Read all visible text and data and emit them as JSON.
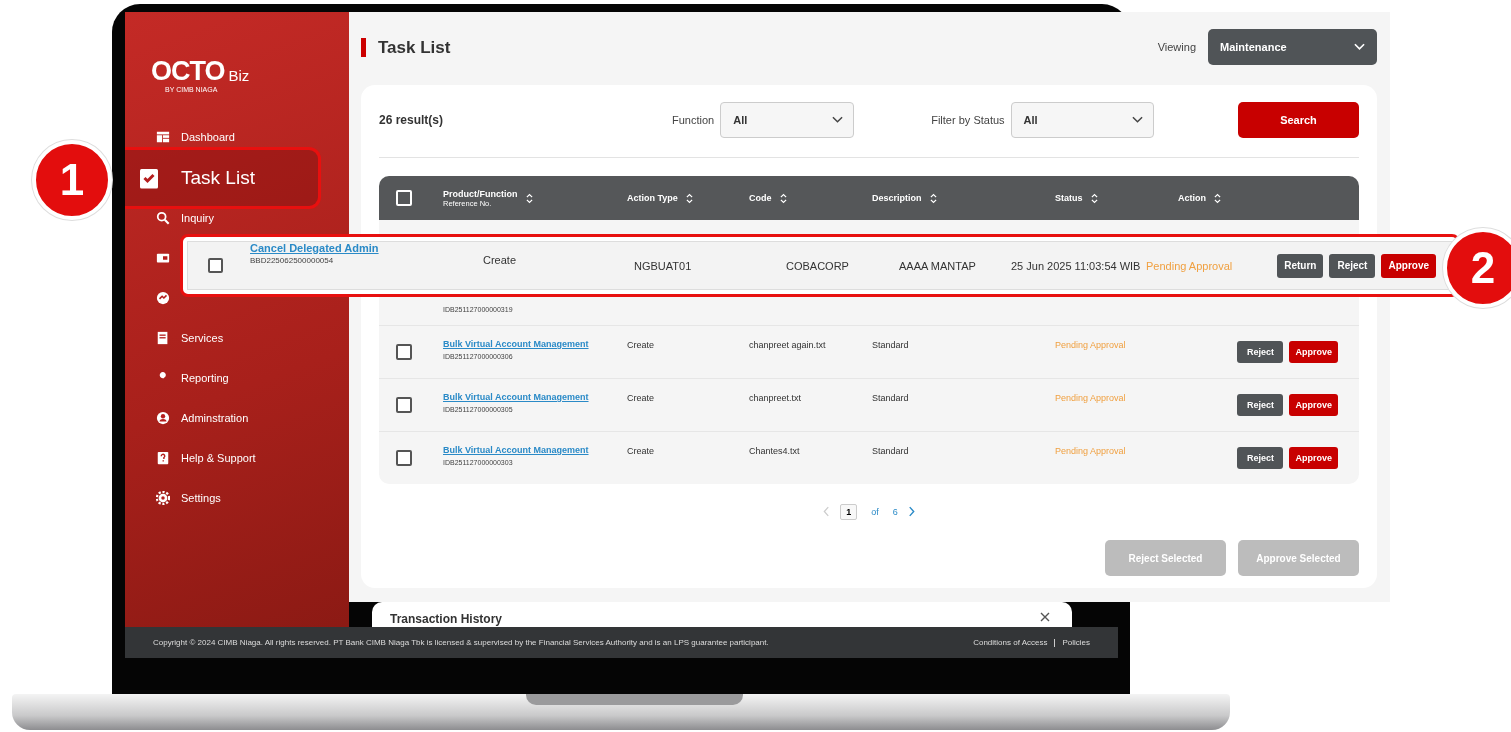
{
  "callouts": [
    {
      "number": "1"
    },
    {
      "number": "2"
    }
  ],
  "sidebar": {
    "logo": "OCTO",
    "logo_suffix": "Biz",
    "logo_byline": "BY CIMB NIAGA",
    "items": [
      {
        "label": "Dashboard",
        "selected": false
      },
      {
        "label": "Task List",
        "selected": true
      },
      {
        "label": "Inquiry",
        "selected": false
      },
      {
        "selected": false
      },
      {
        "selected": false
      },
      {
        "label": "Services",
        "selected": false
      },
      {
        "label": "Reporting",
        "selected": false
      },
      {
        "label": "Adminstration",
        "selected": false
      },
      {
        "label": "Help & Support",
        "selected": false
      },
      {
        "label": "Settings",
        "selected": false
      }
    ]
  },
  "header": {
    "title": "Task List",
    "viewing_label": "Viewing",
    "viewing_value": "Maintenance"
  },
  "filters": {
    "results": "26 result(s)",
    "fields": [
      {
        "label": "Function",
        "value": "All"
      },
      {
        "label": "Filter by Status",
        "value": "All"
      }
    ],
    "search_button": "Search"
  },
  "table": {
    "select_all_checked": false,
    "columns": [
      {
        "label": "Product/Function",
        "sublabel": "Reference No."
      },
      {
        "label": "Action Type"
      },
      {
        "label": "Code"
      },
      {
        "label": "Description"
      },
      {
        "label": "Status"
      },
      {
        "label": "Action"
      }
    ],
    "highlighted_row": {
      "checked": false,
      "product": "Cancel Delegated Admin",
      "reference": "BBD225062500000054",
      "action_type": "Create",
      "code": "NGBUAT01",
      "column_4": "COBACORP",
      "description": "AAAA MANTAP",
      "date": "25 Jun 2025 11:03:54 WIB",
      "status": "Pending Approval",
      "buttons": [
        {
          "kind": "return",
          "label": "Return"
        },
        {
          "kind": "reject",
          "label": "Reject"
        },
        {
          "kind": "approve",
          "label": "Approve"
        }
      ]
    },
    "rows": [
      {
        "kind": "covered",
        "reference": "IDB251127000000319"
      },
      {
        "kind": "full",
        "checked": false,
        "product": "Bulk Virtual Account Management",
        "reference": "IDB251127000000306",
        "action_type": "Create",
        "code": "chanpreet again.txt",
        "description": "Standard",
        "status": "Pending Approval",
        "buttons": [
          {
            "kind": "reject",
            "label": "Reject"
          },
          {
            "kind": "approve",
            "label": "Approve"
          }
        ]
      },
      {
        "kind": "full",
        "checked": false,
        "product": "Bulk Virtual Account Management",
        "reference": "IDB251127000000305",
        "action_type": "Create",
        "code": "chanpreet.txt",
        "description": "Standard",
        "status": "Pending Approval",
        "buttons": [
          {
            "kind": "reject",
            "label": "Reject"
          },
          {
            "kind": "approve",
            "label": "Approve"
          }
        ]
      },
      {
        "kind": "full",
        "checked": false,
        "product": "Bulk Virtual Account Management",
        "reference": "IDB251127000000303",
        "action_type": "Create",
        "code": "Chantes4.txt",
        "description": "Standard",
        "status": "Pending Approval",
        "buttons": [
          {
            "kind": "reject",
            "label": "Reject"
          },
          {
            "kind": "approve",
            "label": "Approve"
          }
        ]
      }
    ]
  },
  "pagination": {
    "current": "1",
    "of": "of",
    "total": "6"
  },
  "bulk_buttons": [
    {
      "label": "Reject Selected",
      "disabled": true
    },
    {
      "label": "Approve Selected",
      "disabled": true
    }
  ],
  "transaction_history": {
    "title": "Transaction History"
  },
  "footer": {
    "copyright": "Copyright © 2024 CIMB Niaga. All rights reserved. PT Bank CIMB Niaga Tbk is licensed & supervised by the Financial Services Authority and is an LPS guarantee participant.",
    "links": [
      "Conditions of Access",
      "Policies"
    ]
  }
}
